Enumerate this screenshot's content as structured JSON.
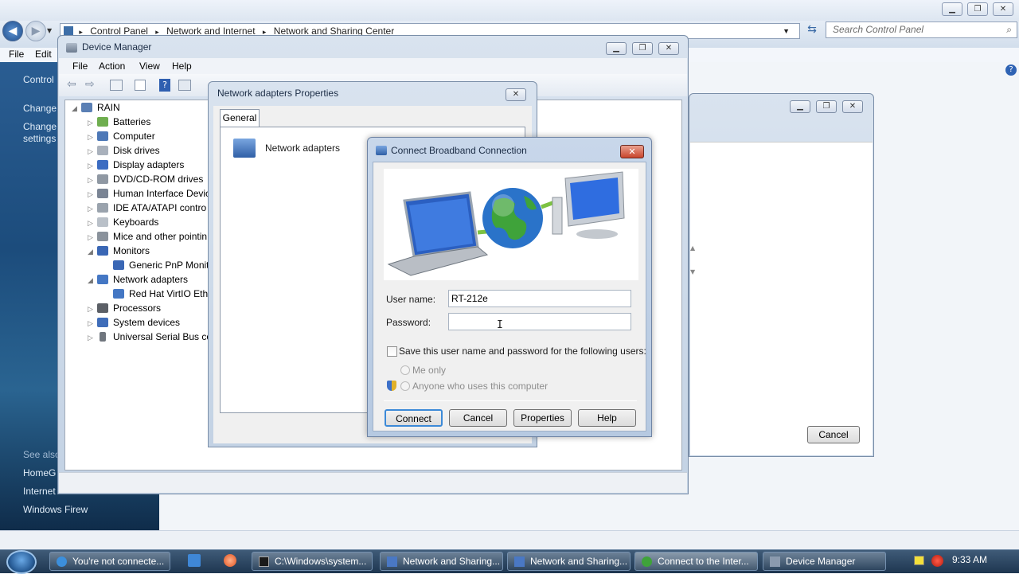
{
  "explorer": {
    "breadcrumb": [
      "Control Panel",
      "Network and Internet",
      "Network and Sharing Center"
    ],
    "search_placeholder": "Search Control Panel",
    "menu": [
      "File",
      "Edit"
    ],
    "left_links": [
      "Control",
      "Change",
      "Change",
      "settings",
      "See also",
      "HomeG",
      "Internet",
      "Windows Firew"
    ]
  },
  "device_manager": {
    "title": "Device Manager",
    "menu": [
      "File",
      "Action",
      "View",
      "Help"
    ],
    "tree": [
      {
        "label": "RAIN",
        "level": 0,
        "expanded": true
      },
      {
        "label": "Batteries",
        "level": 1
      },
      {
        "label": "Computer",
        "level": 1
      },
      {
        "label": "Disk drives",
        "level": 1
      },
      {
        "label": "Display adapters",
        "level": 1
      },
      {
        "label": "DVD/CD-ROM drives",
        "level": 1
      },
      {
        "label": "Human Interface Devic",
        "level": 1
      },
      {
        "label": "IDE ATA/ATAPI contro",
        "level": 1
      },
      {
        "label": "Keyboards",
        "level": 1
      },
      {
        "label": "Mice and other pointin",
        "level": 1
      },
      {
        "label": "Monitors",
        "level": 1,
        "expanded": true
      },
      {
        "label": "Generic PnP Monit",
        "level": 2
      },
      {
        "label": "Network adapters",
        "level": 1,
        "expanded": true
      },
      {
        "label": "Red Hat VirtIO Ethe",
        "level": 2
      },
      {
        "label": "Processors",
        "level": 1
      },
      {
        "label": "System devices",
        "level": 1
      },
      {
        "label": "Universal Serial Bus co",
        "level": 1
      }
    ]
  },
  "properties": {
    "title": "Network adapters Properties",
    "tab": "General",
    "item_label": "Network adapters"
  },
  "background_window": {
    "cancel_label": "Cancel"
  },
  "dialog": {
    "title": "Connect Broadband Connection",
    "username_label": "User name:",
    "username_value": "RT-212e",
    "password_label": "Password:",
    "password_value": "",
    "save_label": "Save this user name and password for the following users:",
    "me_only": "Me only",
    "anyone": "Anyone who uses this computer",
    "connect": "Connect",
    "cancel": "Cancel",
    "properties": "Properties",
    "help": "Help"
  },
  "taskbar": {
    "tasks": [
      "You're not connecte...",
      "C:\\Windows\\system...",
      "Network and Sharing...",
      "Network and Sharing...",
      "Connect to the Inter...",
      "Device Manager"
    ],
    "clock": "9:33 AM"
  }
}
